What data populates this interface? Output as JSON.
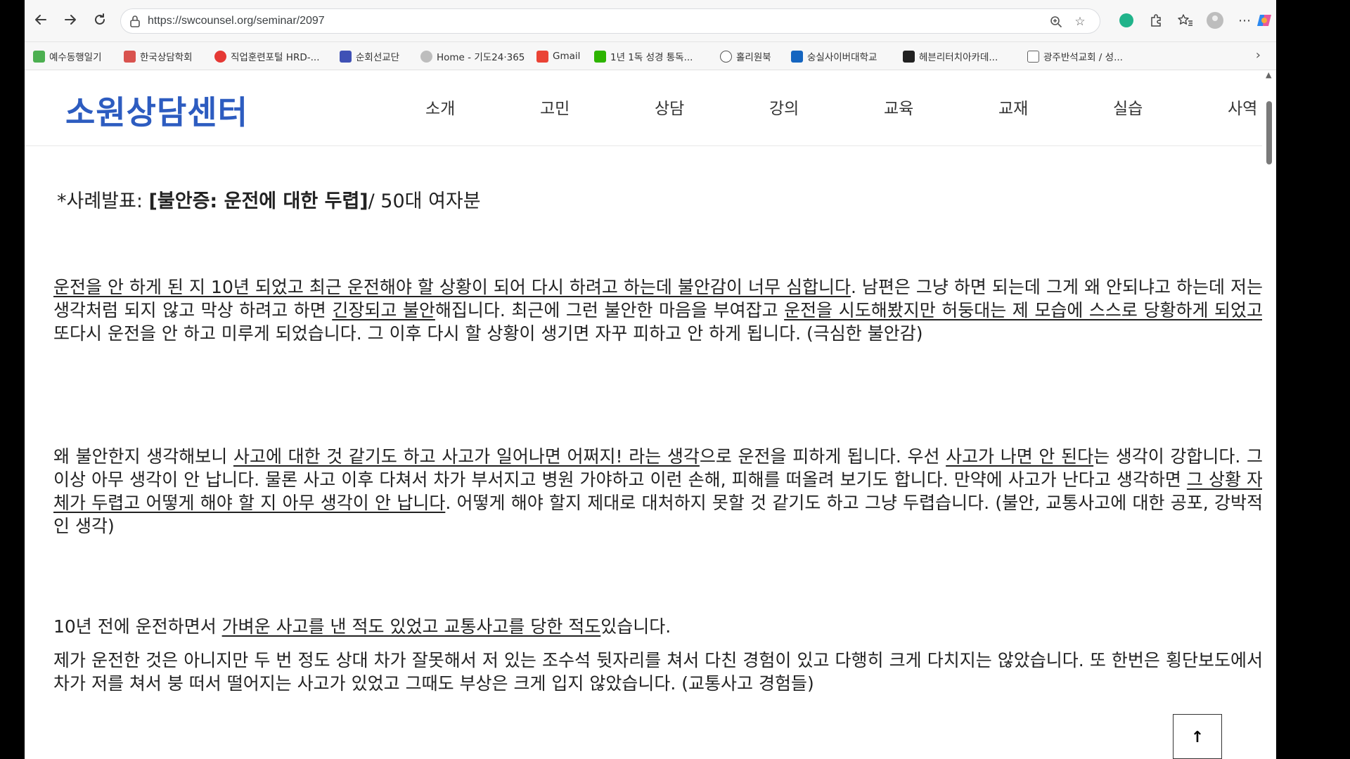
{
  "browser": {
    "url": "https://swcounsel.org/seminar/2097",
    "bookmarks": [
      {
        "label": "예수동행일기",
        "color": "#4caf50"
      },
      {
        "label": "한국상담학회",
        "color": "#d9534f"
      },
      {
        "label": "직업훈련포털 HRD-...",
        "color": "#e53935"
      },
      {
        "label": "순회선교단",
        "color": "#3f51b5"
      },
      {
        "label": "Home - 기도24·365",
        "color": "#bdbdbd"
      },
      {
        "label": "Gmail",
        "color": "#ea4335"
      },
      {
        "label": "1년 1독 성경 통독...",
        "color": "#2db400"
      },
      {
        "label": "홀리원북",
        "color": "#555555"
      },
      {
        "label": "숭실사이버대학교",
        "color": "#1565c0"
      },
      {
        "label": "헤븐리터치아카데...",
        "color": "#212121"
      },
      {
        "label": "광주반석교회 / 성...",
        "color": "#616161"
      }
    ]
  },
  "site": {
    "logo": "소원상담센터",
    "nav": [
      "소개",
      "고민",
      "상담",
      "강의",
      "교육",
      "교재",
      "실습",
      "사역"
    ]
  },
  "article": {
    "title_prefix": "*사례발표: ",
    "title_bold": "[불안증: 운전에 대한 두렵]",
    "title_suffix": "/ 50대 여자분",
    "p1": [
      {
        "t": "운전을 안 하게 된 지 10년 되었고 최근 운전해야 할 상황이 되어 다시 하려고 하는데 불안감이 너무 심합니다",
        "u": true
      },
      {
        "t": ". 남편은 그냥 하면 되는데 그게 왜 안되냐고 하는데 저는 생각처럼 되지 않고 막상 하려고 하면 ",
        "u": false
      },
      {
        "t": "긴장되고 불안",
        "u": true
      },
      {
        "t": "해집니다. 최근에 그런 불안한 마음을 부여잡고 ",
        "u": false
      },
      {
        "t": "운전을 시도해봤지만 허둥대는 제 모습에 스스로 당황하게 되었고",
        "u": true
      },
      {
        "t": "또다시 운전을 안 하고 미루게 되었습니다. 그 이후 다시 할 상황이 생기면 자꾸 피하고 안 하게 됩니다. (극심한 불안감)",
        "u": false
      }
    ],
    "p2": [
      {
        "t": "왜 불안한지 생각해보니 ",
        "u": false
      },
      {
        "t": "사고에 대한 것 같기도 하고 사고가 일어나면 어쩌지! 라는 생각",
        "u": true
      },
      {
        "t": "으로 운전을 피하게 됩니다. 우선 ",
        "u": false
      },
      {
        "t": "사고가 나면 안 된다",
        "u": true
      },
      {
        "t": "는 생각이 강합니다. 그 이상 아무 생각이 안 납니다. 물론 사고 이후 다쳐서 차가 부서지고 병원 가야하고 이런 손해, 피해를 떠올려 보기도 합니다. 만약에 사고가 난다고 생각하면 ",
        "u": false
      },
      {
        "t": "그 상황 자체가 두렵고 어떻게 해야 할 지 아무 생각이 안 납니다",
        "u": true
      },
      {
        "t": ". 어떻게 해야 할지 제대로 대처하지 못할 것 같기도 하고 그냥 두렵습니다. (불안, 교통사고에 대한 공포, 강박적인 생각)",
        "u": false
      }
    ],
    "p3": [
      {
        "t": "10년 전에 운전하면서 ",
        "u": false
      },
      {
        "t": "가벼운 사고를 낸 적도 있었고 교통사고를 당한 적도",
        "u": true
      },
      {
        "t": "있습니다.",
        "u": false
      }
    ],
    "p4": [
      {
        "t": "제가 운전한 것은 아니지만 두 번 정도 상대 차가 잘못해서 저 있는 조수석 뒷자리를 쳐서 다친 경험이 있고 다행히 크게 다치지는 않았습니다. 또 한번은 횡단보도에서 차가 저를 쳐서 붕 떠서 떨어지는 사고가 있었고 그때도 부상은 크게 입지 않았습니다. (교통사고 경험들)",
        "u": false
      }
    ]
  },
  "top_button": "↑"
}
